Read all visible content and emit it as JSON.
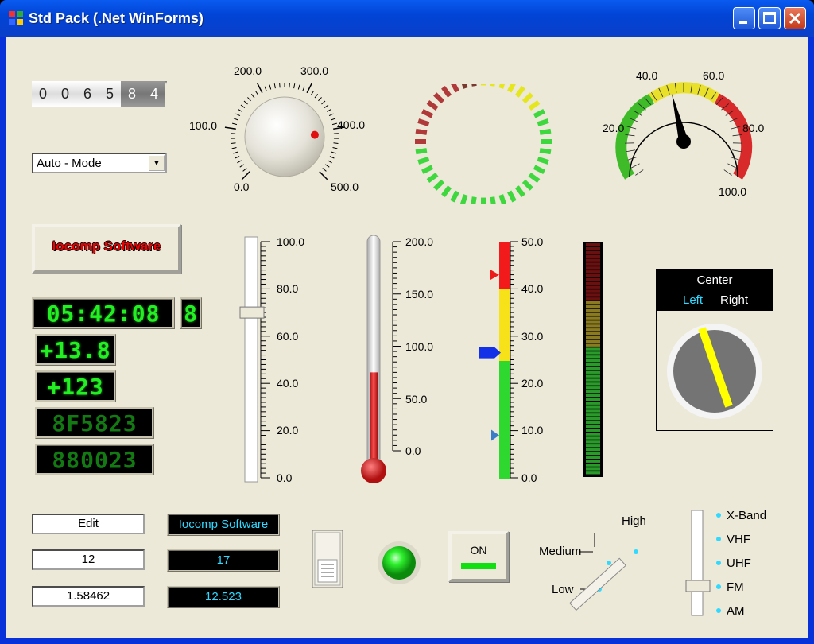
{
  "window": {
    "title": "Std Pack (.Net WinForms)"
  },
  "odometer": {
    "digits": [
      "0",
      "0",
      "6",
      "5",
      "8",
      "4"
    ]
  },
  "mode_combo": {
    "value": "Auto - Mode"
  },
  "knob": {
    "labels": [
      "0.0",
      "100.0",
      "200.0",
      "300.0",
      "400.0",
      "500.0"
    ],
    "value": 410
  },
  "ring_gauge": {
    "segments": 40
  },
  "speedometer": {
    "labels": [
      "20.0",
      "40.0",
      "60.0",
      "80.0",
      "100.0"
    ],
    "value": 50
  },
  "panel_text": "Iocomp Software",
  "clock_led": {
    "time": "05:42:08",
    "extra": "8"
  },
  "led_displays": [
    "+13.8",
    "+123",
    "8F5823",
    "880023"
  ],
  "slider": {
    "labels": [
      "100.0",
      "80.0",
      "60.0",
      "40.0",
      "20.0",
      "0.0"
    ],
    "value": 70
  },
  "thermometer": {
    "labels": [
      "200.0",
      "150.0",
      "100.0",
      "50.0",
      "0.0"
    ],
    "value": 75
  },
  "linear_gauge": {
    "labels": [
      "50.0",
      "40.0",
      "30.0",
      "20.0",
      "10.0",
      "0.0"
    ],
    "red_pointer": 43,
    "blue_pointer": 26.5,
    "blue_small_pointer": 9
  },
  "bar_meter": {
    "segments": 60
  },
  "switch_knob": {
    "header": "Center",
    "left": "Left",
    "right": "Right"
  },
  "edits": {
    "edit1": "Edit",
    "edit2": "12",
    "edit3": "1.58462"
  },
  "displays": {
    "d1": "Iocomp Software",
    "d2": "17",
    "d3": "12.523"
  },
  "on_button": "ON",
  "rotary_switch": {
    "low": "Low",
    "medium": "Medium",
    "high": "High"
  },
  "band_selector": {
    "items": [
      "X-Band",
      "VHF",
      "UHF",
      "FM",
      "AM"
    ],
    "selected": "FM"
  },
  "colors": {
    "title_bar": "#0a3fc9",
    "client": "#ece9d8",
    "led_green": "#23f023",
    "cyan_text": "#2fd9ff"
  }
}
